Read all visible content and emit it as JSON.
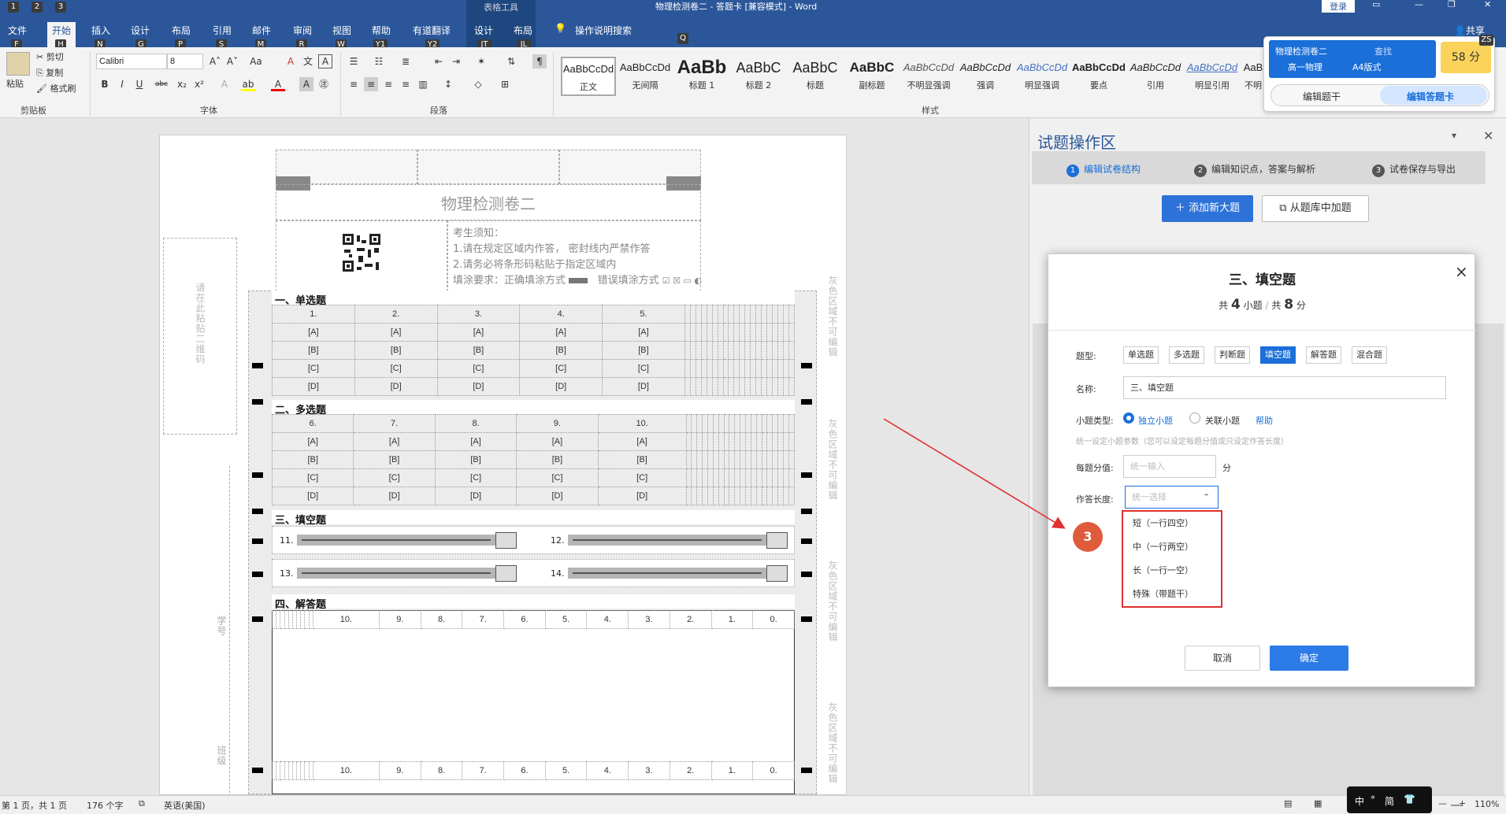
{
  "titlebar": {
    "table_tools": "表格工具",
    "title": "物理检测卷二 - 答题卡 [兼容模式] - Word",
    "login": "登录",
    "keytips": [
      "1",
      "2",
      "3"
    ]
  },
  "tabs": [
    {
      "label": "文件",
      "key": "F"
    },
    {
      "label": "开始",
      "key": "H"
    },
    {
      "label": "插入",
      "key": "N"
    },
    {
      "label": "设计",
      "key": "G"
    },
    {
      "label": "布局",
      "key": "P"
    },
    {
      "label": "引用",
      "key": "S"
    },
    {
      "label": "邮件",
      "key": "M"
    },
    {
      "label": "审阅",
      "key": "R"
    },
    {
      "label": "视图",
      "key": "W"
    },
    {
      "label": "帮助",
      "key": "Y1"
    },
    {
      "label": "有道翻译",
      "key": "Y2"
    },
    {
      "label": "设计",
      "key": "JT"
    },
    {
      "label": "布局",
      "key": "JL"
    }
  ],
  "tell_me": "操作说明搜索",
  "tell_me_key": "Q",
  "share": "共享",
  "share_key": "ZS",
  "ribbon": {
    "clipboard": {
      "paste": "粘贴",
      "cut": "剪切",
      "copy": "复制",
      "format_painter": "格式刷",
      "label": "剪贴板"
    },
    "font": {
      "name": "Calibri",
      "size": "8",
      "label": "字体"
    },
    "paragraph": {
      "label": "段落"
    },
    "styles": {
      "label": "样式",
      "items": [
        {
          "preview": "AaBbCcDd",
          "name": "正文"
        },
        {
          "preview": "AaBbCcDd",
          "name": "无间隔"
        },
        {
          "preview": "AaBb",
          "name": "标题 1"
        },
        {
          "preview": "AaBbC",
          "name": "标题 2"
        },
        {
          "preview": "AaBbC",
          "name": "标题"
        },
        {
          "preview": "AaBbC",
          "name": "副标题"
        },
        {
          "preview": "AaBbCcDd",
          "name": "不明显强调"
        },
        {
          "preview": "AaBbCcDd",
          "name": "强调"
        },
        {
          "preview": "AaBbCcDd",
          "name": "明显强调"
        },
        {
          "preview": "AaBbCcDd",
          "name": "要点"
        },
        {
          "preview": "AaBbCcDd",
          "name": "引用"
        },
        {
          "preview": "AaBbCcDd",
          "name": "明显引用"
        },
        {
          "preview": "AaB",
          "name": "不明"
        }
      ]
    }
  },
  "account_popup": {
    "title": "物理检测卷二",
    "subject": "高一物理",
    "paper": "A4版式",
    "score": "58 分",
    "tab_edit_stem": "编辑题干",
    "tab_edit_card": "编辑答题卡",
    "find": "查找"
  },
  "doc": {
    "title": "物理检测卷二",
    "notice_title": "考生须知：",
    "notice_1": "1.请在规定区域内作答， 密封线内严禁作答",
    "notice_2": "2.请务必将条形码粘贴于指定区域内",
    "fill_req": "填涂要求：正确填涂方式",
    "wrong_fill": "错误填涂方式",
    "barcode_area": "请在此粘贴二维码",
    "side_gray": "灰色区域不可编辑",
    "student_no": "学号",
    "class": "班级",
    "section1": "一、单选题",
    "section2": "二、多选题",
    "section3": "三、填空题",
    "section4": "四、解答题",
    "mc_rows1": [
      [
        "1.",
        "2.",
        "3.",
        "4.",
        "5."
      ],
      [
        "[A]",
        "[A]",
        "[A]",
        "[A]",
        "[A]"
      ],
      [
        "[B]",
        "[B]",
        "[B]",
        "[B]",
        "[B]"
      ],
      [
        "[C]",
        "[C]",
        "[C]",
        "[C]",
        "[C]"
      ],
      [
        "[D]",
        "[D]",
        "[D]",
        "[D]",
        "[D]"
      ]
    ],
    "mc_rows2": [
      [
        "6.",
        "7.",
        "8.",
        "9.",
        "10."
      ],
      [
        "[A]",
        "[A]",
        "[A]",
        "[A]",
        "[A]"
      ],
      [
        "[B]",
        "[B]",
        "[B]",
        "[B]",
        "[B]"
      ],
      [
        "[C]",
        "[C]",
        "[C]",
        "[C]",
        "[C]"
      ],
      [
        "[D]",
        "[D]",
        "[D]",
        "[D]",
        "[D]"
      ]
    ],
    "fill_nums": [
      "11.",
      "12.",
      "13.",
      "14."
    ],
    "score_row": [
      "10.",
      "9.",
      "8.",
      "7.",
      "6.",
      "5.",
      "4.",
      "3.",
      "2.",
      "1.",
      "0."
    ]
  },
  "pane": {
    "title": "试题操作区",
    "steps": [
      {
        "n": "1",
        "label": "编辑试卷结构"
      },
      {
        "n": "2",
        "label": "编辑知识点，答案与解析"
      },
      {
        "n": "3",
        "label": "试卷保存与导出"
      }
    ],
    "add_section": "添加新大题",
    "add_from_bank": "从题库中加题"
  },
  "dialog": {
    "title": "三、填空题",
    "summary_prefix": "共",
    "count": "4",
    "count_unit": "小题",
    "divider": "/",
    "total_prefix": "共",
    "total": "8",
    "total_unit": "分",
    "type_label": "题型:",
    "types": [
      "单选题",
      "多选题",
      "判断题",
      "填空题",
      "解答题",
      "混合题"
    ],
    "active_type": "填空题",
    "name_label": "名称:",
    "name_value": "三、填空题",
    "subtype_label": "小题类型:",
    "subtype_independent": "独立小题",
    "subtype_linked": "关联小题",
    "help": "帮助",
    "hint": "统一设定小题参数（您可以设定每题分值或只设定作答长度）",
    "score_label": "每题分值:",
    "score_placeholder": "统一输入",
    "score_unit": "分",
    "length_label": "作答长度:",
    "length_placeholder": "统一选择",
    "length_options": [
      "短（一行四空）",
      "中（一行两空）",
      "长（一行一空）",
      "特殊（带题干）"
    ],
    "cancel": "取消",
    "ok": "确定",
    "close": "×"
  },
  "annotation": {
    "badge": "3",
    "color": "#e05a3c"
  },
  "status": {
    "page": "第 1 页，共 1 页",
    "words": "176 个字",
    "lang": "英语(美国)",
    "zoom": "110%",
    "ime": "中",
    "ime2": "简"
  },
  "colors": {
    "word_blue": "#2b579a",
    "accent": "#1a73e8",
    "red_outline": "#e03030"
  }
}
